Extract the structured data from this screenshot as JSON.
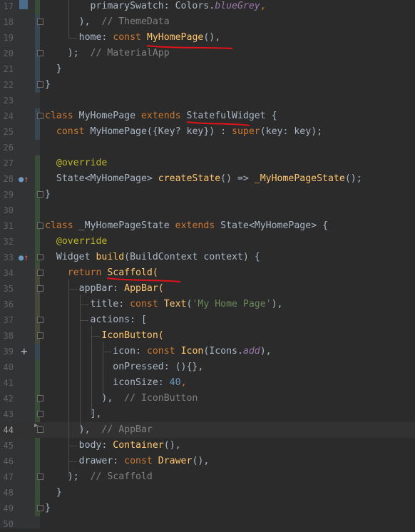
{
  "editor": {
    "current_line": 44,
    "lines": [
      {
        "n": "17",
        "vcs": "add",
        "fold": false,
        "tokens": [
          {
            "t": "        primarySwatch: Colors.",
            "c": ""
          },
          {
            "t": "blueGrey",
            "c": "prop"
          },
          {
            "t": ",",
            "c": "kw"
          }
        ]
      },
      {
        "n": "18",
        "vcs": "mod",
        "fold": true,
        "tokens": [
          {
            "t": "      ),  ",
            "c": ""
          },
          {
            "t": "// ThemeData",
            "c": "cmt"
          }
        ]
      },
      {
        "n": "19",
        "vcs": "mod",
        "fold": false,
        "tokens": [
          {
            "t": "      home: ",
            "c": ""
          },
          {
            "t": "const ",
            "c": "kw"
          },
          {
            "t": "MyHomePage",
            "c": "cls"
          },
          {
            "t": "(),",
            "c": ""
          }
        ]
      },
      {
        "n": "20",
        "vcs": "mod",
        "fold": true,
        "tokens": [
          {
            "t": "    );  ",
            "c": ""
          },
          {
            "t": "// MaterialApp",
            "c": "cmt"
          }
        ]
      },
      {
        "n": "21",
        "vcs": "mod",
        "fold": false,
        "tokens": [
          {
            "t": "  }",
            "c": ""
          }
        ]
      },
      {
        "n": "22",
        "vcs": "mod",
        "fold": true,
        "tokens": [
          {
            "t": "}",
            "c": ""
          }
        ]
      },
      {
        "n": "23",
        "vcs": "",
        "fold": false,
        "tokens": []
      },
      {
        "n": "24",
        "vcs": "mod",
        "fold": true,
        "tokens": [
          {
            "t": "class ",
            "c": "kw"
          },
          {
            "t": "MyHomePage ",
            "c": ""
          },
          {
            "t": "extends ",
            "c": "kw"
          },
          {
            "t": "StatefulWidget {",
            "c": ""
          }
        ]
      },
      {
        "n": "25",
        "vcs": "mod",
        "fold": false,
        "tokens": [
          {
            "t": "  ",
            "c": ""
          },
          {
            "t": "const ",
            "c": "kw"
          },
          {
            "t": "MyHomePage({Key? key}) : ",
            "c": ""
          },
          {
            "t": "super",
            "c": "kw"
          },
          {
            "t": "(key: key);",
            "c": ""
          }
        ]
      },
      {
        "n": "26",
        "vcs": "",
        "fold": false,
        "tokens": []
      },
      {
        "n": "27",
        "vcs": "add",
        "fold": false,
        "tokens": [
          {
            "t": "  ",
            "c": ""
          },
          {
            "t": "@override",
            "c": "ann"
          }
        ]
      },
      {
        "n": "28",
        "vcs": "add",
        "fold": false,
        "icon": "override",
        "tokens": [
          {
            "t": "  State<MyHomePage> ",
            "c": ""
          },
          {
            "t": "createState",
            "c": "cls"
          },
          {
            "t": "() => ",
            "c": ""
          },
          {
            "t": "_MyHomePageState",
            "c": "cls"
          },
          {
            "t": "();",
            "c": ""
          }
        ]
      },
      {
        "n": "29",
        "vcs": "add",
        "fold": true,
        "tokens": [
          {
            "t": "}",
            "c": ""
          }
        ]
      },
      {
        "n": "30",
        "vcs": "add",
        "fold": false,
        "tokens": []
      },
      {
        "n": "31",
        "vcs": "add",
        "fold": true,
        "tokens": [
          {
            "t": "class ",
            "c": "kw"
          },
          {
            "t": "_MyHomePageState ",
            "c": ""
          },
          {
            "t": "extends ",
            "c": "kw"
          },
          {
            "t": "State<MyHomePage> {",
            "c": ""
          }
        ]
      },
      {
        "n": "32",
        "vcs": "add",
        "fold": false,
        "tokens": [
          {
            "t": "  ",
            "c": ""
          },
          {
            "t": "@override",
            "c": "ann"
          }
        ]
      },
      {
        "n": "33",
        "vcs": "add",
        "fold": true,
        "icon": "override",
        "tokens": [
          {
            "t": "  Widget ",
            "c": ""
          },
          {
            "t": "build",
            "c": "cls"
          },
          {
            "t": "(BuildContext context) {",
            "c": ""
          }
        ]
      },
      {
        "n": "34",
        "vcs": "mixed",
        "fold": true,
        "tokens": [
          {
            "t": "    ",
            "c": ""
          },
          {
            "t": "return ",
            "c": "kw"
          },
          {
            "t": "Scaffold(",
            "c": "cls"
          }
        ]
      },
      {
        "n": "35",
        "vcs": "mixed",
        "fold": true,
        "tokens": [
          {
            "t": "      appBar: ",
            "c": ""
          },
          {
            "t": "AppBar(",
            "c": "cls"
          }
        ]
      },
      {
        "n": "36",
        "vcs": "mixed",
        "fold": false,
        "tokens": [
          {
            "t": "        title: ",
            "c": ""
          },
          {
            "t": "const ",
            "c": "kw"
          },
          {
            "t": "Text",
            "c": "cls"
          },
          {
            "t": "(",
            "c": ""
          },
          {
            "t": "'My Home Page'",
            "c": "str"
          },
          {
            "t": "),",
            "c": ""
          }
        ]
      },
      {
        "n": "37",
        "vcs": "mixed",
        "fold": true,
        "tokens": [
          {
            "t": "        actions: [",
            "c": ""
          }
        ]
      },
      {
        "n": "38",
        "vcs": "mixed",
        "fold": true,
        "tokens": [
          {
            "t": "          ",
            "c": ""
          },
          {
            "t": "IconButton(",
            "c": "cls"
          }
        ]
      },
      {
        "n": "39",
        "vcs": "mod",
        "fold": false,
        "icon": "plus",
        "tokens": [
          {
            "t": "            icon: ",
            "c": ""
          },
          {
            "t": "const ",
            "c": "kw"
          },
          {
            "t": "Icon",
            "c": "cls"
          },
          {
            "t": "(Icons.",
            "c": ""
          },
          {
            "t": "add",
            "c": "prop"
          },
          {
            "t": "),",
            "c": ""
          }
        ]
      },
      {
        "n": "40",
        "vcs": "add",
        "fold": false,
        "tokens": [
          {
            "t": "            onPressed: (){},",
            "c": ""
          }
        ]
      },
      {
        "n": "41",
        "vcs": "add",
        "fold": false,
        "tokens": [
          {
            "t": "            iconSize: ",
            "c": ""
          },
          {
            "t": "40",
            "c": "num"
          },
          {
            "t": ",",
            "c": "kw"
          }
        ]
      },
      {
        "n": "42",
        "vcs": "add",
        "fold": true,
        "tokens": [
          {
            "t": "          ),  ",
            "c": ""
          },
          {
            "t": "// IconButton",
            "c": "cmt"
          }
        ]
      },
      {
        "n": "43",
        "vcs": "add",
        "fold": true,
        "tokens": [
          {
            "t": "        ],",
            "c": ""
          }
        ]
      },
      {
        "n": "44",
        "vcs": "",
        "fold": true,
        "icon": "arrow",
        "tokens": [
          {
            "t": "      ),  ",
            "c": ""
          },
          {
            "t": "// AppBar",
            "c": "cmt"
          }
        ]
      },
      {
        "n": "45",
        "vcs": "add",
        "fold": false,
        "tokens": [
          {
            "t": "      body: ",
            "c": ""
          },
          {
            "t": "Container",
            "c": "cls"
          },
          {
            "t": "(),",
            "c": ""
          }
        ]
      },
      {
        "n": "46",
        "vcs": "add",
        "fold": false,
        "tokens": [
          {
            "t": "      drawer: ",
            "c": ""
          },
          {
            "t": "const ",
            "c": "kw"
          },
          {
            "t": "Drawer",
            "c": "cls"
          },
          {
            "t": "(),",
            "c": ""
          }
        ]
      },
      {
        "n": "47",
        "vcs": "add",
        "fold": true,
        "tokens": [
          {
            "t": "    );  ",
            "c": ""
          },
          {
            "t": "// Scaffold",
            "c": "cmt"
          }
        ]
      },
      {
        "n": "48",
        "vcs": "add",
        "fold": false,
        "tokens": [
          {
            "t": "  }",
            "c": ""
          }
        ]
      },
      {
        "n": "49",
        "vcs": "add",
        "fold": true,
        "tokens": [
          {
            "t": "}",
            "c": ""
          }
        ]
      },
      {
        "n": "50",
        "vcs": "",
        "fold": false,
        "tokens": []
      }
    ]
  },
  "colors": {
    "background": "#2b2b2b",
    "gutter": "#313335",
    "keyword": "#cc7832",
    "function": "#ffc66d",
    "comment": "#808080",
    "string": "#6a8759",
    "number": "#6897bb",
    "annotation": "#bbb529",
    "annotation_ink": "#e0121b"
  },
  "icons": {
    "override": "override-up-arrow-icon",
    "plus": "add-plus-icon",
    "arrow": "fold-arrow-icon"
  }
}
